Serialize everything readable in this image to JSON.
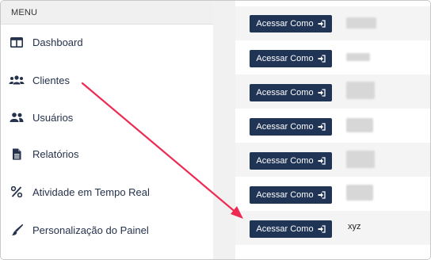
{
  "sidebar": {
    "header": "MENU",
    "items": [
      {
        "label": "Dashboard",
        "icon": "columns-icon"
      },
      {
        "label": "Clientes",
        "icon": "users-group-icon"
      },
      {
        "label": "Usuários",
        "icon": "user-pair-icon"
      },
      {
        "label": "Relatórios",
        "icon": "document-icon"
      },
      {
        "label": "Atividade em Tempo Real",
        "icon": "percent-icon"
      },
      {
        "label": "Personalização do Painel",
        "icon": "brush-icon"
      }
    ]
  },
  "clients": {
    "button_label": "Acessar Como",
    "button_icon": "sign-in-icon",
    "rows": [
      {
        "name": ""
      },
      {
        "name": ""
      },
      {
        "name": ""
      },
      {
        "name": ""
      },
      {
        "name": ""
      },
      {
        "name": ""
      },
      {
        "name": "xyz"
      }
    ]
  },
  "annotation": {
    "color": "#ee2a52",
    "icon": "red-arrow-annotation"
  },
  "colors": {
    "button_bg": "#203456",
    "nav_text": "#25324b"
  }
}
